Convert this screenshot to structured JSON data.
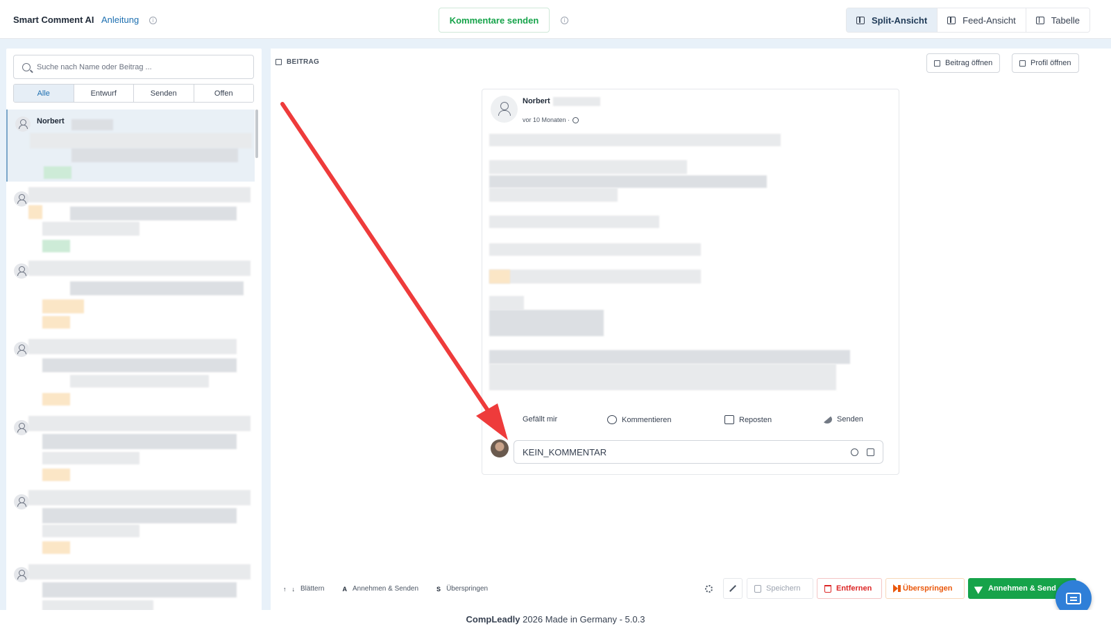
{
  "header": {
    "brand": "Smart Comment AI",
    "guide_link": "Anleitung",
    "send_comments": "Kommentare senden",
    "views": [
      {
        "label": "Split-Ansicht",
        "active": true
      },
      {
        "label": "Feed-Ansicht",
        "active": false
      },
      {
        "label": "Tabelle",
        "active": false
      }
    ]
  },
  "sidebar": {
    "search_placeholder": "Suche nach Name oder Beitrag ...",
    "filters": [
      "Alle",
      "Entwurf",
      "Senden",
      "Offen"
    ],
    "active_filter": "Alle",
    "first_item_name": "Norbert"
  },
  "post": {
    "section_label": "BEITRAG",
    "open_post": "Beitrag öffnen",
    "open_profile": "Profil öffnen",
    "author": "Norbert",
    "time": "vor 10 Monaten ·",
    "actions": [
      "Gefällt mir",
      "Kommentieren",
      "Reposten",
      "Senden"
    ],
    "comment_value": "KEIN_KOMMENTAR"
  },
  "shortcuts": {
    "up_key": "↑",
    "down_key": "↓",
    "browse": "Blättern",
    "accept_key": "A",
    "accept": "Annehmen & Senden",
    "skip_key": "S",
    "skip": "Überspringen"
  },
  "buttons": {
    "save": "Speichern",
    "remove": "Entfernen",
    "skip": "Überspringen",
    "accept_send": "Annehmen & Send"
  },
  "footer": {
    "brand": "CompLeadly",
    "text": "2026 Made in Germany - 5.0.3"
  },
  "colors": {
    "accent_green": "#16a34a",
    "danger_red": "#dc2626",
    "warning_orange": "#ea580c",
    "annotation_arrow": "#ee3b3b"
  }
}
